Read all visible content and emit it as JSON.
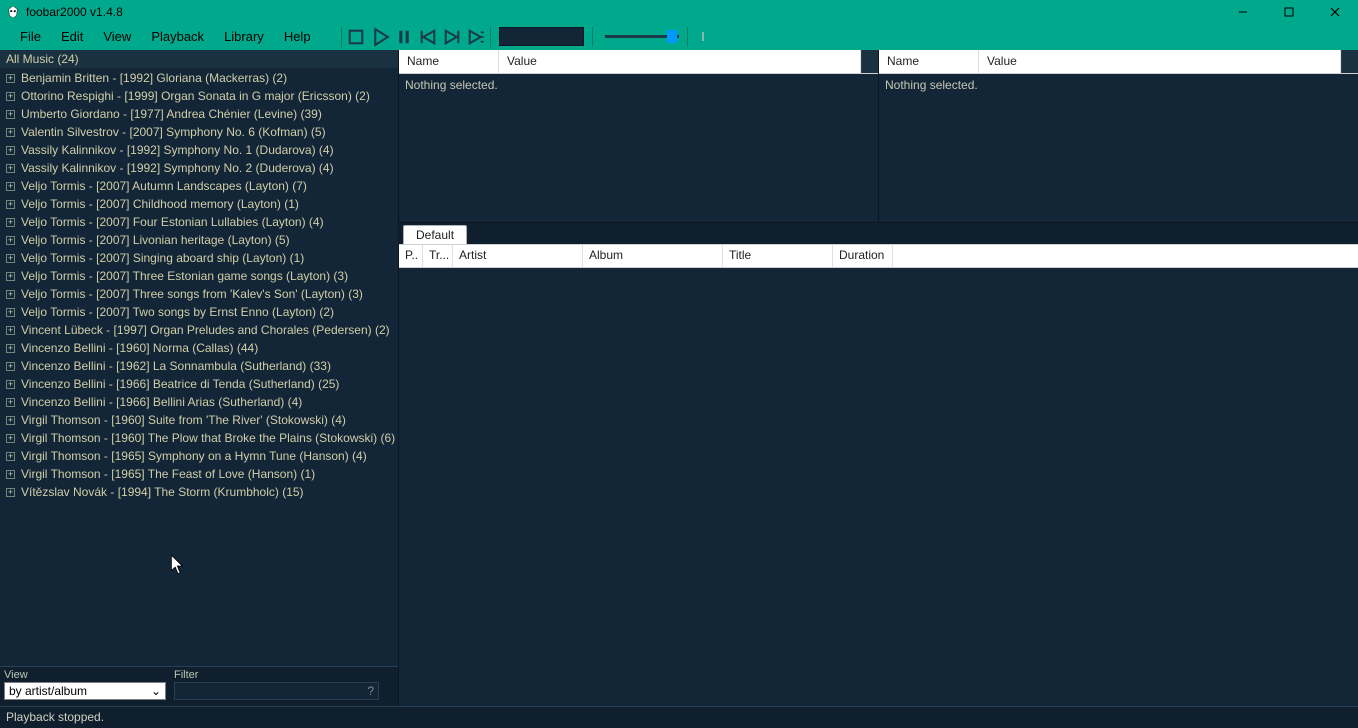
{
  "window": {
    "title": "foobar2000 v1.4.8"
  },
  "menu": [
    "File",
    "Edit",
    "View",
    "Playback",
    "Library",
    "Help"
  ],
  "library": {
    "header": "All Music (24)",
    "items": [
      "Benjamin Britten - [1992] Gloriana (Mackerras) (2)",
      "Ottorino Respighi - [1999] Organ Sonata in G major (Ericsson) (2)",
      "Umberto Giordano - [1977] Andrea Chénier (Levine) (39)",
      "Valentin Silvestrov - [2007] Symphony No. 6 (Kofman) (5)",
      "Vassily Kalinnikov - [1992] Symphony No. 1 (Dudarova) (4)",
      "Vassily Kalinnikov - [1992] Symphony No. 2 (Duderova) (4)",
      "Veljo Tormis - [2007] Autumn Landscapes (Layton) (7)",
      "Veljo Tormis - [2007] Childhood memory (Layton) (1)",
      "Veljo Tormis - [2007] Four Estonian Lullabies (Layton) (4)",
      "Veljo Tormis - [2007] Livonian heritage (Layton) (5)",
      "Veljo Tormis - [2007] Singing aboard ship (Layton) (1)",
      "Veljo Tormis - [2007] Three Estonian game songs (Layton) (3)",
      "Veljo Tormis - [2007] Three songs from 'Kalev's Son' (Layton) (3)",
      "Veljo Tormis - [2007] Two songs by Ernst Enno (Layton) (2)",
      "Vincent Lübeck - [1997] Organ Preludes and Chorales (Pedersen) (2)",
      "Vincenzo Bellini - [1960] Norma (Callas) (44)",
      "Vincenzo Bellini - [1962] La Sonnambula (Sutherland) (33)",
      "Vincenzo Bellini - [1966] Beatrice di Tenda (Sutherland) (25)",
      "Vincenzo Bellini - [1966] Bellini Arias (Sutherland) (4)",
      "Virgil Thomson - [1960] Suite from 'The River' (Stokowski) (4)",
      "Virgil Thomson - [1960] The Plow that Broke the Plains (Stokowski) (6)",
      "Virgil Thomson - [1965] Symphony on a Hymn Tune (Hanson) (4)",
      "Virgil Thomson - [1965] The Feast of Love (Hanson) (1)",
      "Vítězslav Novák - [1994] The Storm (Krumbholc) (15)"
    ]
  },
  "viewFilter": {
    "viewLabel": "View",
    "viewValue": "by artist/album",
    "filterLabel": "Filter",
    "filterHint": "?"
  },
  "props": {
    "nameCol": "Name",
    "valueCol": "Value",
    "empty": "Nothing selected."
  },
  "playlist": {
    "tab": "Default",
    "columns": [
      "P..",
      "Tr...",
      "Artist",
      "Album",
      "Title",
      "Duration"
    ]
  },
  "status": "Playback stopped.",
  "volume": {
    "position": 0.83
  }
}
